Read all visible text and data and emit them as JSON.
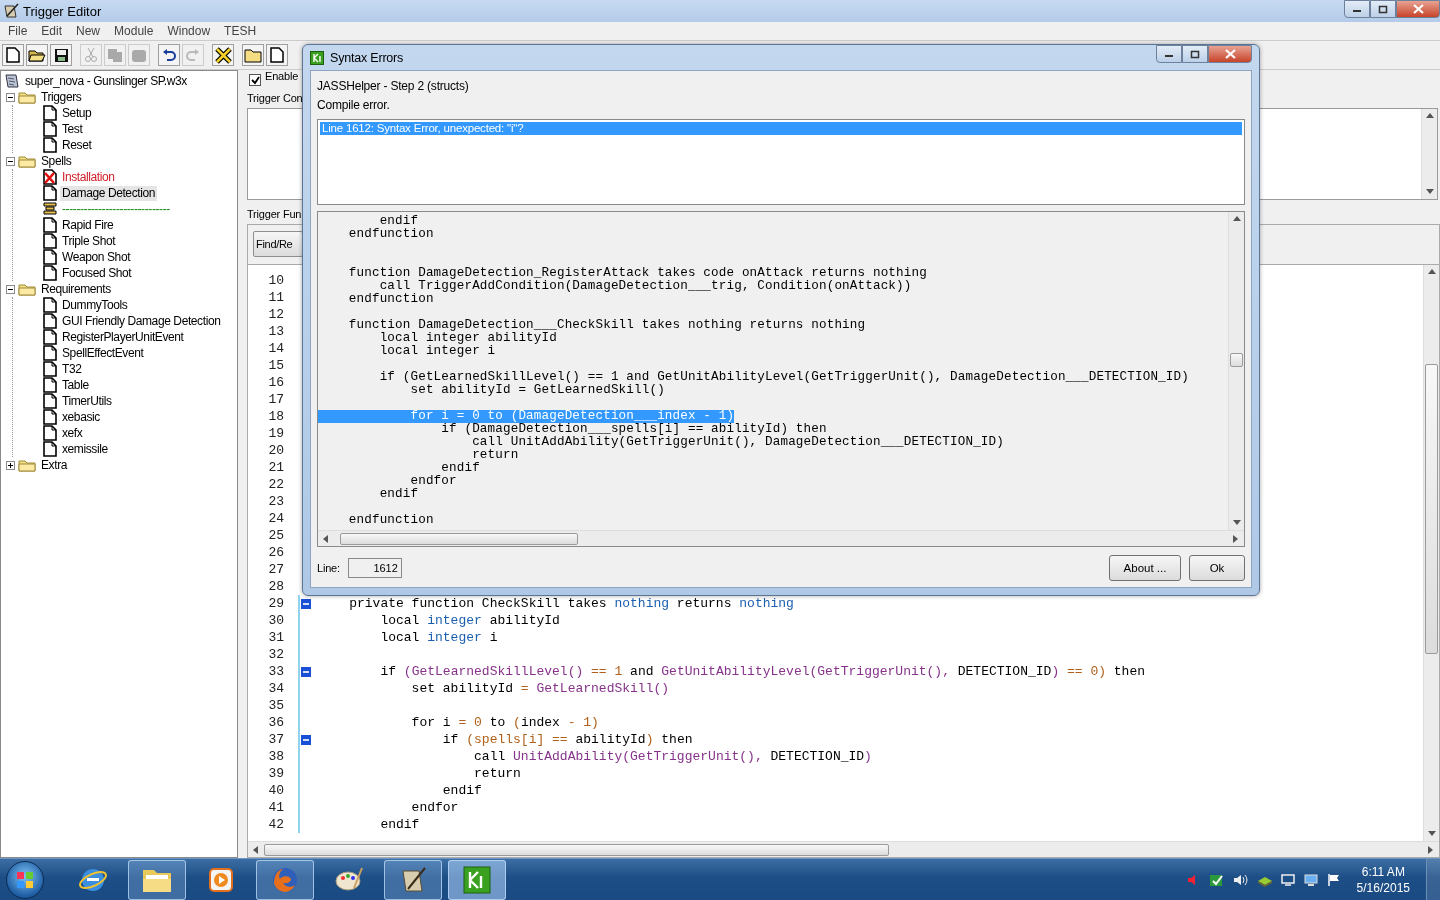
{
  "window": {
    "title": "Trigger Editor"
  },
  "menu": [
    "File",
    "Edit",
    "New",
    "Module",
    "Window",
    "TESH"
  ],
  "toolbar": [
    {
      "kind": "new",
      "disabled": false
    },
    {
      "kind": "open",
      "disabled": false
    },
    {
      "kind": "save",
      "disabled": false
    },
    {
      "kind": "cut",
      "disabled": true
    },
    {
      "kind": "copy",
      "disabled": true
    },
    {
      "kind": "paste",
      "disabled": true
    },
    {
      "kind": "undo",
      "disabled": false
    },
    {
      "kind": "redo",
      "disabled": true
    },
    {
      "kind": "delete",
      "disabled": false
    },
    {
      "kind": "folder",
      "disabled": false
    },
    {
      "kind": "page",
      "disabled": false
    }
  ],
  "tree": {
    "label": "super_nova - Gunslinger SP.w3x",
    "children": [
      {
        "label": "Triggers",
        "expanded": true,
        "children": [
          {
            "label": "Setup",
            "kind": "trigger",
            "selected": false
          },
          {
            "label": "Test",
            "kind": "trigger",
            "selected": false
          },
          {
            "label": "Reset",
            "kind": "trigger",
            "selected": false
          }
        ]
      },
      {
        "label": "Spells",
        "expanded": true,
        "children": [
          {
            "label": "Installation",
            "kind": "error",
            "selected": false
          },
          {
            "label": "Damage Detection",
            "kind": "trigger",
            "selected": true
          },
          {
            "label": "------------------------------",
            "kind": "comment",
            "selected": false
          },
          {
            "label": "Rapid Fire",
            "kind": "trigger",
            "selected": false
          },
          {
            "label": "Triple Shot",
            "kind": "trigger",
            "selected": false
          },
          {
            "label": "Weapon Shot",
            "kind": "trigger",
            "selected": false
          },
          {
            "label": "Focused Shot",
            "kind": "trigger",
            "selected": false
          }
        ]
      },
      {
        "label": "Requirements",
        "expanded": true,
        "children": [
          {
            "label": "DummyTools",
            "kind": "trigger",
            "selected": false
          },
          {
            "label": "GUI Friendly Damage Detection",
            "kind": "trigger",
            "selected": false
          },
          {
            "label": "RegisterPlayerUnitEvent",
            "kind": "trigger",
            "selected": false
          },
          {
            "label": "SpellEffectEvent",
            "kind": "trigger",
            "selected": false
          },
          {
            "label": "T32",
            "kind": "trigger",
            "selected": false
          },
          {
            "label": "Table",
            "kind": "trigger",
            "selected": false
          },
          {
            "label": "TimerUtils",
            "kind": "trigger",
            "selected": false
          },
          {
            "label": "xebasic",
            "kind": "trigger",
            "selected": false
          },
          {
            "label": "xefx",
            "kind": "trigger",
            "selected": false
          },
          {
            "label": "xemissile",
            "kind": "trigger",
            "selected": false
          }
        ]
      },
      {
        "label": "Extra",
        "expanded": false
      }
    ]
  },
  "editor": {
    "enabled_label": "Enable",
    "enabled": true,
    "comment_label": "Trigger Con",
    "functions_label": "Trigger Fun",
    "find_button": "Find/Re",
    "lines": [
      {
        "number": "10",
        "fold": false
      },
      {
        "number": "11",
        "fold": false
      },
      {
        "number": "12",
        "fold": false
      },
      {
        "number": "13",
        "fold": false
      },
      {
        "number": "14",
        "fold": false
      },
      {
        "number": "15",
        "fold": false
      },
      {
        "number": "16",
        "fold": false
      },
      {
        "number": "17",
        "fold": false
      },
      {
        "number": "18",
        "fold": false
      },
      {
        "number": "19",
        "fold": false
      },
      {
        "number": "20",
        "fold": false
      },
      {
        "number": "21",
        "fold": false
      },
      {
        "number": "22",
        "fold": false
      },
      {
        "number": "23",
        "fold": false
      },
      {
        "number": "24",
        "fold": false
      },
      {
        "number": "25",
        "fold": false
      },
      {
        "number": "26",
        "fold": false
      },
      {
        "number": "27",
        "fold": false
      },
      {
        "number": "28",
        "fold": false
      },
      {
        "number": "29",
        "fold": true,
        "tokens": [
          {
            "text": "    private function CheckSkill takes ",
            "kind": "plain"
          },
          {
            "text": "nothing",
            "kind": "type"
          },
          {
            "text": " returns ",
            "kind": "plain"
          },
          {
            "text": "nothing",
            "kind": "type"
          }
        ]
      },
      {
        "number": "30",
        "fold": false,
        "tokens": [
          {
            "text": "        local ",
            "kind": "plain"
          },
          {
            "text": "integer",
            "kind": "type"
          },
          {
            "text": " abilityId",
            "kind": "plain"
          }
        ]
      },
      {
        "number": "31",
        "fold": false,
        "tokens": [
          {
            "text": "        local ",
            "kind": "plain"
          },
          {
            "text": "integer",
            "kind": "type"
          },
          {
            "text": " i",
            "kind": "plain"
          }
        ]
      },
      {
        "number": "32",
        "fold": false
      },
      {
        "number": "33",
        "fold": true,
        "tokens": [
          {
            "text": "        if ",
            "kind": "plain"
          },
          {
            "text": "(GetLearnedSkillLevel()",
            "kind": "func"
          },
          {
            "text": " == 1",
            "kind": "op"
          },
          {
            "text": " and ",
            "kind": "plain"
          },
          {
            "text": "GetUnitAbilityLevel(GetTriggerUnit(),",
            "kind": "func"
          },
          {
            "text": " DETECTION_ID",
            "kind": "plain"
          },
          {
            "text": ")",
            "kind": "func"
          },
          {
            "text": " == 0)",
            "kind": "op"
          },
          {
            "text": " then",
            "kind": "plain"
          }
        ]
      },
      {
        "number": "34",
        "fold": false,
        "tokens": [
          {
            "text": "            set abilityId ",
            "kind": "plain"
          },
          {
            "text": "= ",
            "kind": "op"
          },
          {
            "text": "GetLearnedSkill()",
            "kind": "func"
          }
        ]
      },
      {
        "number": "35",
        "fold": false
      },
      {
        "number": "36",
        "fold": false,
        "tokens": [
          {
            "text": "            for i ",
            "kind": "plain"
          },
          {
            "text": "= 0",
            "kind": "op"
          },
          {
            "text": " to ",
            "kind": "plain"
          },
          {
            "text": "(",
            "kind": "op"
          },
          {
            "text": "index ",
            "kind": "plain"
          },
          {
            "text": "- 1)",
            "kind": "op"
          }
        ]
      },
      {
        "number": "37",
        "fold": true,
        "tokens": [
          {
            "text": "                if ",
            "kind": "plain"
          },
          {
            "text": "(spells[i] ==",
            "kind": "op"
          },
          {
            "text": " abilityId",
            "kind": "plain"
          },
          {
            "text": ")",
            "kind": "op"
          },
          {
            "text": " then",
            "kind": "plain"
          }
        ]
      },
      {
        "number": "38",
        "fold": false,
        "tokens": [
          {
            "text": "                    call ",
            "kind": "plain"
          },
          {
            "text": "UnitAddAbility(GetTriggerUnit(),",
            "kind": "func"
          },
          {
            "text": " DETECTION_ID",
            "kind": "plain"
          },
          {
            "text": ")",
            "kind": "func"
          }
        ]
      },
      {
        "number": "39",
        "fold": false,
        "tokens": [
          {
            "text": "                    return",
            "kind": "plain"
          }
        ]
      },
      {
        "number": "40",
        "fold": false,
        "tokens": [
          {
            "text": "                endif",
            "kind": "plain"
          }
        ]
      },
      {
        "number": "41",
        "fold": false,
        "tokens": [
          {
            "text": "            endfor",
            "kind": "plain"
          }
        ]
      },
      {
        "number": "42",
        "fold": false,
        "tokens": [
          {
            "text": "        endif",
            "kind": "plain"
          }
        ]
      }
    ]
  },
  "dialog": {
    "title": "Syntax Errors",
    "step": "JASSHelper - Step 2 (structs)",
    "status": "Compile error.",
    "errors": [
      {
        "text": "Line 1612: Syntax Error, unexpected: \"i\"?",
        "selected": true
      }
    ],
    "code": [
      {
        "kind": "code",
        "text": "        endif",
        "selected": false
      },
      {
        "kind": "code",
        "text": "    endfunction",
        "selected": false
      },
      {
        "kind": "blank"
      },
      {
        "kind": "blank"
      },
      {
        "kind": "code",
        "text": "    function DamageDetection_RegisterAttack takes code onAttack returns nothing",
        "selected": false
      },
      {
        "kind": "code",
        "text": "        call TriggerAddCondition(DamageDetection___trig, Condition(onAttack))",
        "selected": false
      },
      {
        "kind": "code",
        "text": "    endfunction",
        "selected": false
      },
      {
        "kind": "blank"
      },
      {
        "kind": "code",
        "text": "    function DamageDetection___CheckSkill takes nothing returns nothing",
        "selected": false
      },
      {
        "kind": "code",
        "text": "        local integer abilityId",
        "selected": false
      },
      {
        "kind": "code",
        "text": "        local integer i",
        "selected": false
      },
      {
        "kind": "blank"
      },
      {
        "kind": "code",
        "text": "        if (GetLearnedSkillLevel() == 1 and GetUnitAbilityLevel(GetTriggerUnit(), DamageDetection___DETECTION_ID)",
        "selected": false
      },
      {
        "kind": "code",
        "text": "            set abilityId = GetLearnedSkill()",
        "selected": false
      },
      {
        "kind": "blank"
      },
      {
        "kind": "code",
        "text": "            for i = 0 to (DamageDetection___index - 1)",
        "selected": true
      },
      {
        "kind": "code",
        "text": "                if (DamageDetection___spells[i] == abilityId) then",
        "selected": false
      },
      {
        "kind": "code",
        "text": "                    call UnitAddAbility(GetTriggerUnit(), DamageDetection___DETECTION_ID)",
        "selected": false
      },
      {
        "kind": "code",
        "text": "                    return",
        "selected": false
      },
      {
        "kind": "code",
        "text": "                endif",
        "selected": false
      },
      {
        "kind": "code",
        "text": "            endfor",
        "selected": false
      },
      {
        "kind": "code",
        "text": "        endif",
        "selected": false
      },
      {
        "kind": "blank"
      },
      {
        "kind": "code",
        "text": "    endfunction",
        "selected": false
      }
    ],
    "line_label": "Line:",
    "line_value": "1612",
    "buttons": [
      "About ...",
      "Ok"
    ]
  },
  "taskbar": {
    "apps": [
      {
        "kind": "globe",
        "running": false,
        "selected": false
      },
      {
        "kind": "folder",
        "running": true,
        "selected": false
      },
      {
        "kind": "player",
        "running": false,
        "selected": false
      },
      {
        "kind": "fox",
        "running": true,
        "selected": false
      },
      {
        "kind": "palette",
        "running": false,
        "selected": false
      },
      {
        "kind": "quill",
        "running": true,
        "selected": false
      },
      {
        "kind": "editor",
        "running": true,
        "selected": true
      }
    ],
    "time": "6:11 AM",
    "date": "5/16/2015"
  }
}
